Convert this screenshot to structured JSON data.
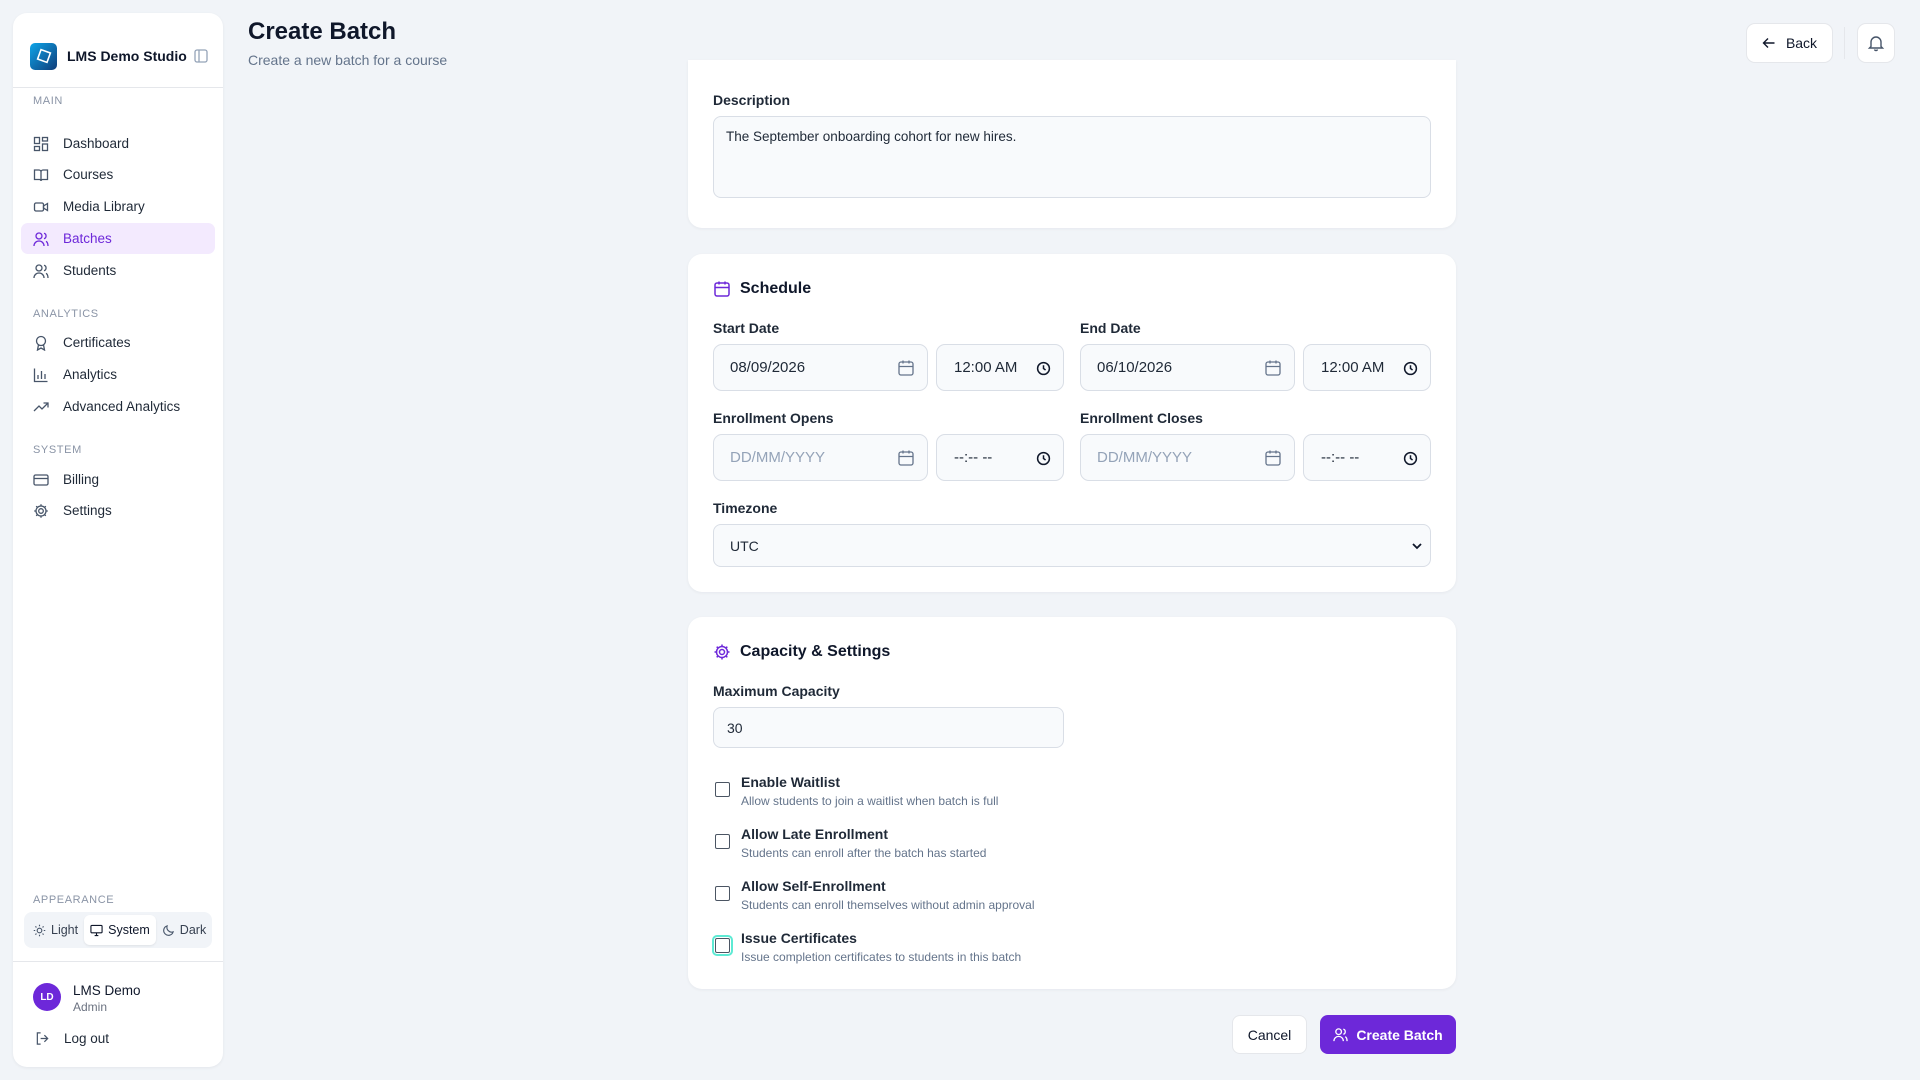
{
  "brand": {
    "name": "LMS Demo Studio"
  },
  "sidebar": {
    "sections": {
      "main": "MAIN",
      "analytics": "ANALYTICS",
      "system": "SYSTEM",
      "appearance": "APPEARANCE"
    },
    "items": [
      {
        "label": "Dashboard",
        "icon": "dashboard-icon"
      },
      {
        "label": "Courses",
        "icon": "book-icon"
      },
      {
        "label": "Media Library",
        "icon": "video-icon"
      },
      {
        "label": "Batches",
        "icon": "users-icon",
        "active": true
      },
      {
        "label": "Students",
        "icon": "users-icon"
      },
      {
        "label": "Certificates",
        "icon": "award-icon"
      },
      {
        "label": "Analytics",
        "icon": "bar-chart-icon"
      },
      {
        "label": "Advanced Analytics",
        "icon": "trending-up-icon"
      },
      {
        "label": "Billing",
        "icon": "credit-card-icon"
      },
      {
        "label": "Settings",
        "icon": "gear-icon"
      }
    ],
    "theme": {
      "light": "Light",
      "system": "System",
      "dark": "Dark",
      "selected": "System"
    },
    "user": {
      "initials": "LD",
      "name": "LMS Demo",
      "role": "Admin"
    },
    "logout": "Log out"
  },
  "header": {
    "title": "Create Batch",
    "subtitle": "Create a new batch for a course",
    "back_label": "Back"
  },
  "description": {
    "label": "Description",
    "value": "The September onboarding cohort for new hires."
  },
  "schedule": {
    "title": "Schedule",
    "start_date_label": "Start Date",
    "start_date": "08/09/2026",
    "start_time": "12:00 AM",
    "end_date_label": "End Date",
    "end_date": "06/10/2026",
    "end_time": "12:00 AM",
    "enroll_open_label": "Enrollment Opens",
    "enroll_open_date_placeholder": "DD/MM/YYYY",
    "enroll_open_time_placeholder": "--:-- --",
    "enroll_close_label": "Enrollment Closes",
    "enroll_close_date_placeholder": "DD/MM/YYYY",
    "enroll_close_time_placeholder": "--:-- --",
    "timezone_label": "Timezone",
    "timezone_value": "UTC"
  },
  "capacity": {
    "title": "Capacity & Settings",
    "max_label": "Maximum Capacity",
    "max_value": "30",
    "options": [
      {
        "title": "Enable Waitlist",
        "desc": "Allow students to join a waitlist when batch is full",
        "checked": false
      },
      {
        "title": "Allow Late Enrollment",
        "desc": "Students can enroll after the batch has started",
        "checked": false
      },
      {
        "title": "Allow Self-Enrollment",
        "desc": "Students can enroll themselves without admin approval",
        "checked": false
      },
      {
        "title": "Issue Certificates",
        "desc": "Issue completion certificates to students in this batch",
        "checked": false
      }
    ]
  },
  "footer": {
    "cancel_label": "Cancel",
    "create_label": "Create Batch"
  },
  "colors": {
    "accent": "#6d28d9",
    "accent_bg": "#f3eafe",
    "page_bg": "#f1f4f8"
  }
}
